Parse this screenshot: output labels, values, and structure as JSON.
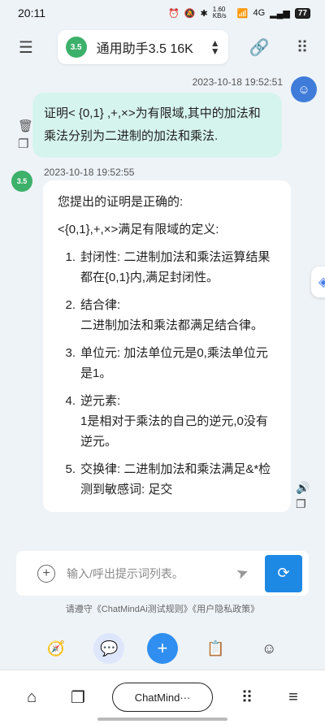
{
  "status": {
    "time": "20:11",
    "speed": "1.60 KB/s",
    "network": "4G",
    "battery": "77"
  },
  "header": {
    "model_name": "通用助手3.5 16K",
    "logo_text": "3.5"
  },
  "user_message": {
    "timestamp": "2023-10-18 19:52:51",
    "text": "证明< {0,1} ,+,×>为有限域,其中的加法和乘法分别为二进制的加法和乘法."
  },
  "bot_message": {
    "timestamp": "2023-10-18 19:52:55",
    "logo_text": "3.5",
    "intro": "您提出的证明是正确的:",
    "subtitle": "<{0,1},+,×>满足有限域的定义:",
    "items": [
      {
        "num": "1.",
        "text": "封闭性: 二进制加法和乘法运算结果都在{0,1}内,满足封闭性。"
      },
      {
        "num": "2.",
        "text": "结合律:\n二进制加法和乘法都满足结合律。"
      },
      {
        "num": "3.",
        "text": "单位元: 加法单位元是0,乘法单位元是1。"
      },
      {
        "num": "4.",
        "text": "逆元素:\n1是相对于乘法的自己的逆元,0没有逆元。"
      },
      {
        "num": "5.",
        "text": "交换律: 二进制加法和乘法满足&*检测到敏感词: 足交"
      }
    ]
  },
  "input": {
    "placeholder": "输入/呼出提示词列表。"
  },
  "notice": "请遵守《ChatMindAi测试规则》《用户隐私政策》",
  "nav": {
    "center_label": "ChatMind···"
  }
}
